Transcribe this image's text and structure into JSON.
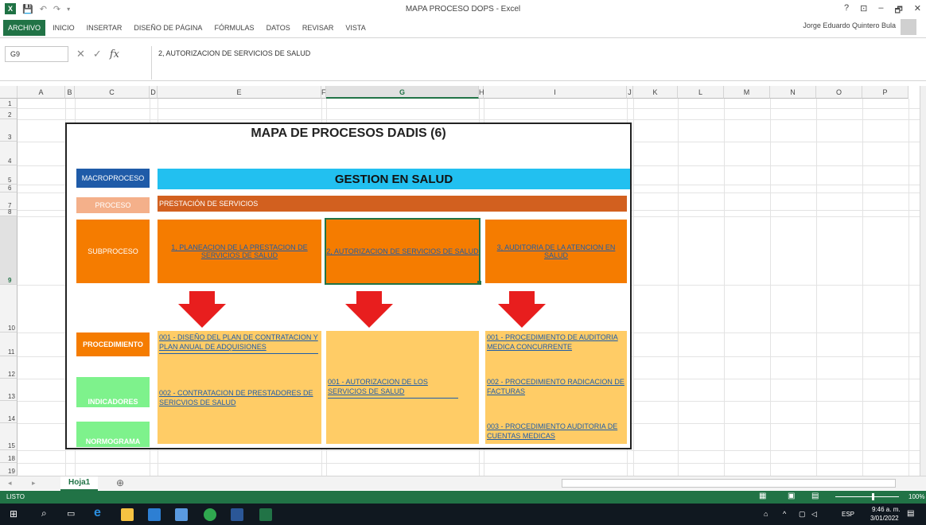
{
  "window": {
    "title": "MAPA PROCESO DOPS - Excel",
    "qat_icon": "excel-icon",
    "help": "?",
    "minimize": "–",
    "restore": "🗗",
    "close": "✕",
    "ribbon_display": "⊡"
  },
  "ribbon": {
    "tabs": [
      "ARCHIVO",
      "INICIO",
      "INSERTAR",
      "DISEÑO DE PÁGINA",
      "FÓRMULAS",
      "DATOS",
      "REVISAR",
      "VISTA"
    ],
    "user": "Jorge Eduardo Quintero Bula"
  },
  "formula_bar": {
    "name_box": "G9",
    "fx": "fx",
    "formula": "2, AUTORIZACION DE SERVICIOS DE SALUD"
  },
  "columns": [
    "A",
    "B",
    "C",
    "D",
    "E",
    "F",
    "G",
    "H",
    "I",
    "J",
    "K",
    "L",
    "M",
    "N",
    "O",
    "P"
  ],
  "rows": [
    "1",
    "2",
    "3",
    "4",
    "5",
    "6",
    "7",
    "8",
    "9",
    "10",
    "11",
    "12",
    "13",
    "14",
    "15",
    "18",
    "19"
  ],
  "selected_cell": {
    "column": "G",
    "row": "9"
  },
  "map": {
    "title": "MAPA DE PROCESOS DADIS (6)",
    "macroproceso_label": "MACROPROCESO",
    "macroproceso_value": "GESTION EN SALUD",
    "proceso_label": "PROCESO",
    "proceso_value": "PRESTACIÓN DE SERVICIOS",
    "subproceso_label": "SUBPROCESO",
    "subprocesos": [
      "1, PLANEACION DE LA PRESTACION DE SERVICIOS DE SALUD",
      "2, AUTORIZACION DE SERVICIOS DE SALUD",
      "3, AUDITORIA DE LA ATENCION EN SALUD"
    ],
    "procedimiento_label": "PROCEDIMIENTO",
    "indicadores_label": "INDICADORES",
    "normograma_label": "NORMOGRAMA",
    "col1_links": [
      "001 - DISEÑO DEL PLAN DE CONTRATACION Y PLAN ANUAL DE ADQUISIONES",
      "002 - CONTRATACION DE PRESTADORES DE SERICVIOS DE SALUD"
    ],
    "col2_links": [
      "001 -   AUTORIZACION DE LOS SERVICIOS DE SALUD"
    ],
    "col3_links": [
      "001 - PROCEDIMIENTO DE AUDITORIA MEDICA CONCURRENTE",
      "002 - PROCEDIMIENTO RADICACION DE FACTURAS",
      "003 - PROCEDIMIENTO AUDITORIA DE CUENTAS MEDICAS"
    ]
  },
  "sheet_tabs": [
    "Hoja1"
  ],
  "add_sheet": "⊕",
  "status": {
    "mode": "LISTO",
    "zoom": "100%"
  },
  "taskbar": {
    "lang": "ESP",
    "time": "9:46 a. m.",
    "date": "3/01/2022"
  },
  "colors": {
    "excel_green": "#217346",
    "blue_label": "#1f5ba8",
    "cyan_banner": "#22c0f0",
    "orange_bar": "#d2601f",
    "orange_box": "#f57c00",
    "light_orange": "#ffcc66",
    "green_label": "#7ef28c",
    "peach": "#f4b08a",
    "arrow_red": "#e81e1e"
  }
}
